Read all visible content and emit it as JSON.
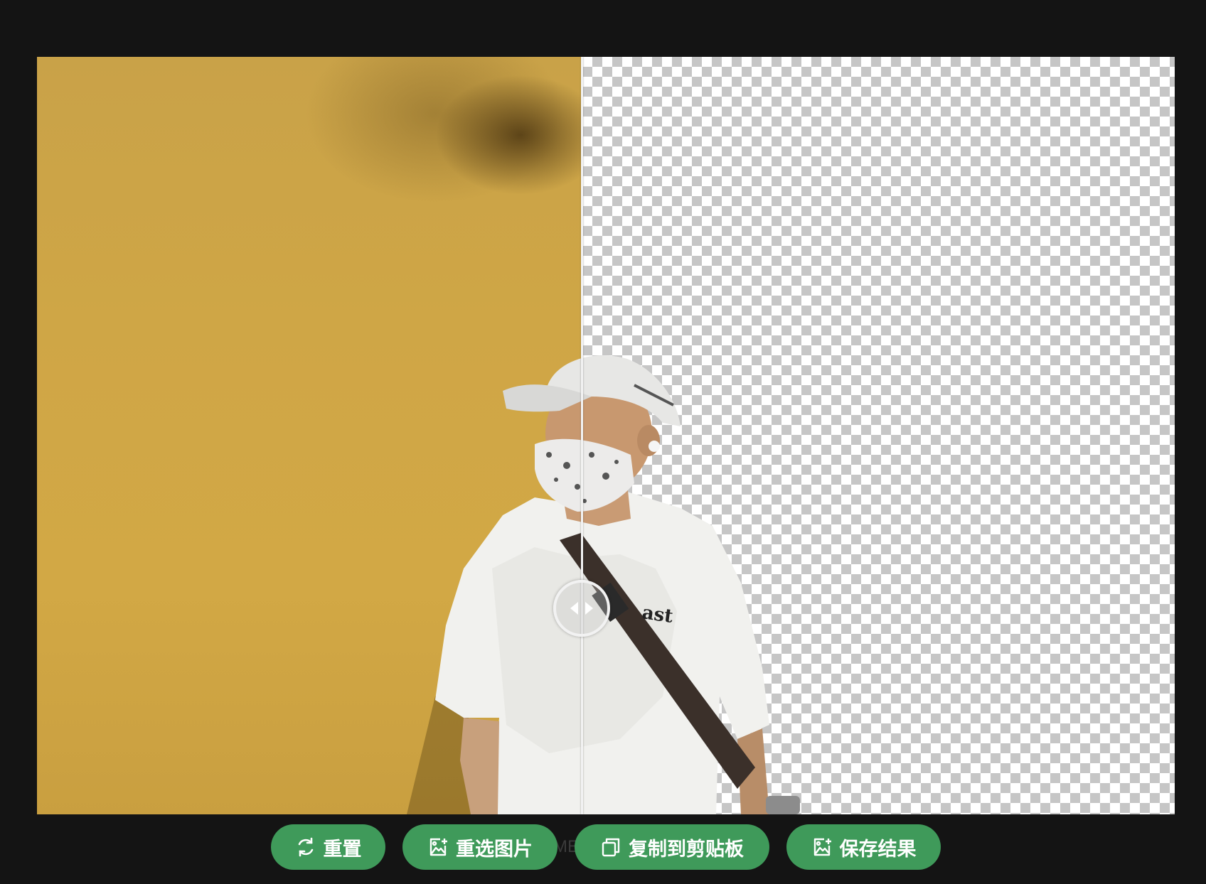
{
  "editor": {
    "original_label": "",
    "result_label": ""
  },
  "watermark": {
    "text": "ME"
  },
  "toolbar": {
    "buttons": [
      {
        "label": "重置",
        "icon": "refresh-icon"
      },
      {
        "label": "重选图片",
        "icon": "image-add-icon"
      },
      {
        "label": "复制到剪贴板",
        "icon": "copy-icon"
      },
      {
        "label": "保存结果",
        "icon": "image-save-icon"
      }
    ]
  },
  "colors": {
    "background": "#141414",
    "button": "#3f9a5a",
    "original_backdrop": "#d0a645",
    "checker_gray": "#c6c6c6"
  }
}
